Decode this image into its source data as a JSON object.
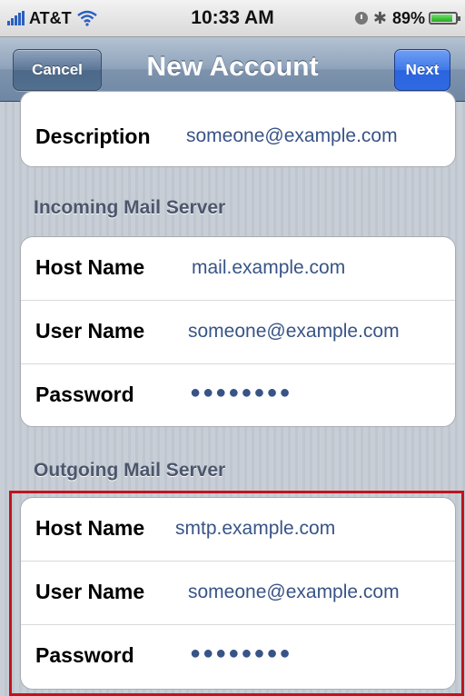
{
  "status_bar": {
    "carrier": "AT&T",
    "time": "10:33 AM",
    "battery_percent": "89%",
    "battery_level": 0.89
  },
  "navbar": {
    "title": "New Account",
    "cancel_label": "Cancel",
    "next_label": "Next"
  },
  "account": {
    "description_label": "Description",
    "description_value": "someone@example.com"
  },
  "incoming": {
    "heading": "Incoming Mail Server",
    "host_label": "Host Name",
    "host_value": "mail.example.com",
    "user_label": "User Name",
    "user_value": "someone@example.com",
    "password_label": "Password",
    "password_value": "●●●●●●●●"
  },
  "outgoing": {
    "heading": "Outgoing Mail Server",
    "host_label": "Host Name",
    "host_value": "smtp.example.com",
    "user_label": "User Name",
    "user_value": "someone@example.com",
    "password_label": "Password",
    "password_value": "●●●●●●●●"
  },
  "colors": {
    "value_text": "#385487",
    "highlight_border": "#c0141c",
    "next_button": "#2f6ae2"
  }
}
